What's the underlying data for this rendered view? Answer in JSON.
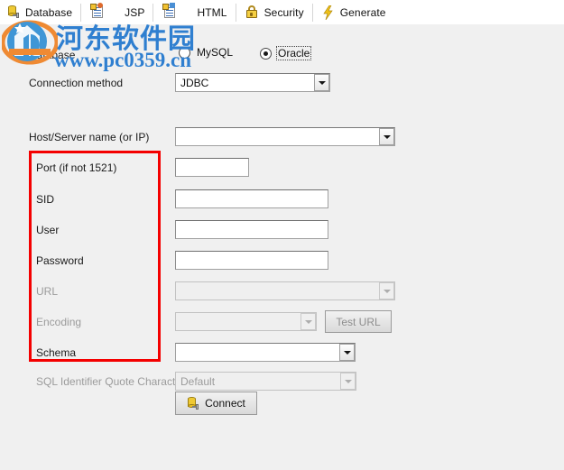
{
  "window": {
    "bg_color": "#f0f0f0",
    "tabstrip_bg": "#ffffff"
  },
  "tabs": [
    {
      "id": "database",
      "label": "Database",
      "icon": "database-icon",
      "selected": true
    },
    {
      "id": "jsp",
      "label": "JSP",
      "icon": "jsp-document-icon",
      "selected": false
    },
    {
      "id": "html",
      "label": "HTML",
      "icon": "html-document-icon",
      "selected": false
    },
    {
      "id": "security",
      "label": "Security",
      "icon": "lock-icon",
      "selected": false
    },
    {
      "id": "generate",
      "label": "Generate",
      "icon": "lightning-bolt-icon",
      "selected": false
    }
  ],
  "form": {
    "group_label": "Database",
    "db_type": {
      "options": [
        "MySQL",
        "Oracle"
      ],
      "selected": "Oracle",
      "mysql_label": "MySQL",
      "oracle_label": "Oracle"
    },
    "rows": [
      {
        "id": "connection-method",
        "label": "Connection method",
        "control": "combo",
        "value": "JDBC",
        "disabled": false
      },
      {
        "id": "host-server-name",
        "label": "Host/Server name (or IP)",
        "control": "combo",
        "value": "",
        "disabled": false
      },
      {
        "id": "port",
        "label": "Port (if not 1521)",
        "control": "text",
        "value": "",
        "disabled": false
      },
      {
        "id": "sid",
        "label": "SID",
        "control": "text",
        "value": "",
        "disabled": false
      },
      {
        "id": "user",
        "label": "User",
        "control": "text",
        "value": "",
        "disabled": false
      },
      {
        "id": "password",
        "label": "Password",
        "control": "text",
        "value": "",
        "disabled": false
      },
      {
        "id": "url",
        "label": "URL",
        "control": "combo",
        "value": "",
        "disabled": true
      },
      {
        "id": "encoding",
        "label": "Encoding",
        "control": "combo",
        "value": "",
        "disabled": true
      },
      {
        "id": "schema",
        "label": "Schema",
        "control": "combo",
        "value": "",
        "disabled": false
      },
      {
        "id": "sql-identifier-quote-character",
        "label": "SQL Identifier Quote Character",
        "control": "combo",
        "value": "Default",
        "disabled": true
      }
    ],
    "test_url_button": {
      "label": "Test URL",
      "disabled": true
    },
    "connect_button": {
      "label": "Connect",
      "icon": "database-connect-icon",
      "disabled": false
    }
  },
  "annotation": {
    "shape": "rectangle",
    "color": "#f40000",
    "encloses": [
      "Port (if not 1521)",
      "SID",
      "User",
      "Password",
      "URL",
      "Encoding",
      "Schema"
    ]
  },
  "watermark": {
    "site_name_cn": "河东软件园",
    "site_url": "www.pc0359.cn",
    "color": "#2f7fd0",
    "logo_colors": {
      "blue": "#3f96d6",
      "orange": "#ef8a33"
    }
  }
}
